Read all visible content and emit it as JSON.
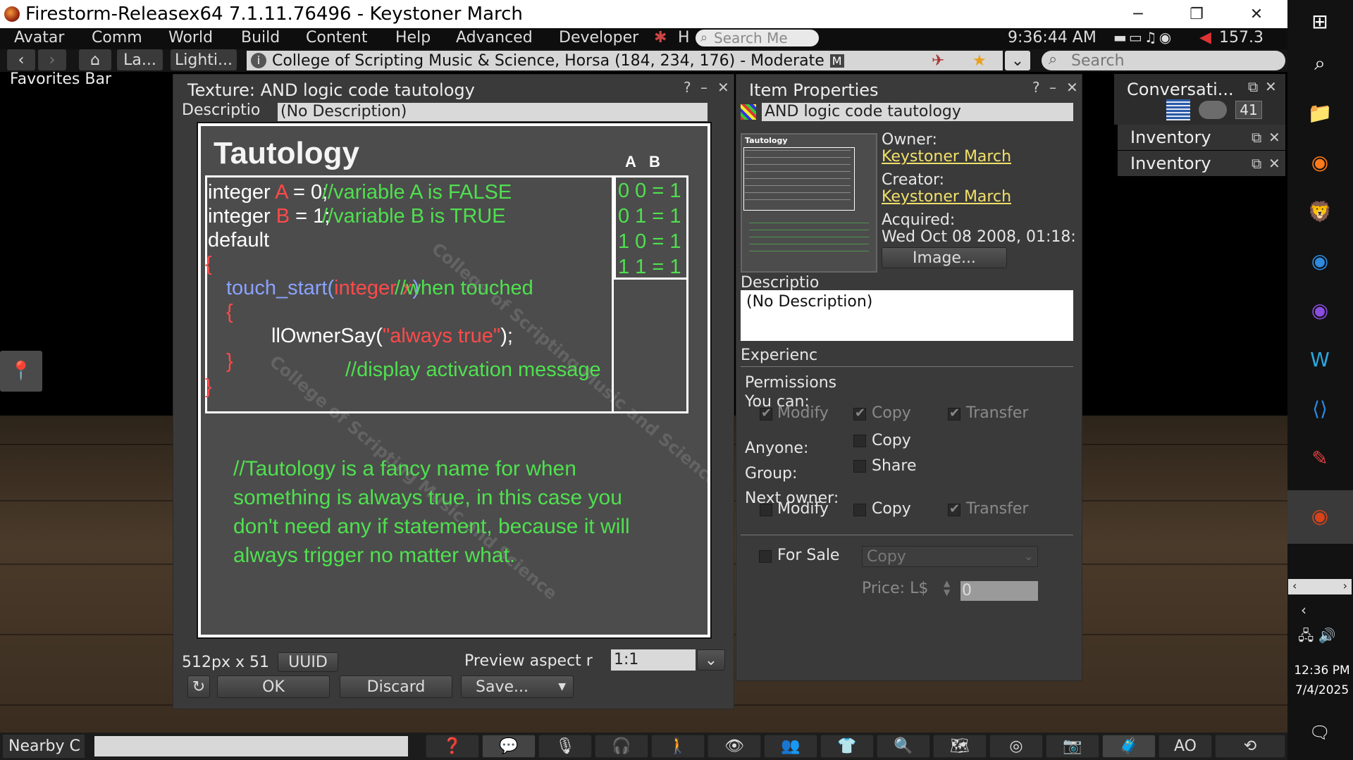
{
  "window": {
    "title": "Firestorm-Releasex64 7.1.11.76496 - Keystoner March",
    "minimize": "─",
    "restore": "❐",
    "close": "✕"
  },
  "menu": {
    "items": [
      "Avatar",
      "Comm",
      "World",
      "Build",
      "Content",
      "Help",
      "Advanced",
      "Developer"
    ],
    "search_placeholder": "Search Me",
    "h_label": "H",
    "clock": "9:36:44 AM",
    "fps": "157.3"
  },
  "nav": {
    "back": "‹",
    "forward": "›",
    "home": "⌂",
    "landmark_btn": "La...",
    "lighting_btn": "Lighti...",
    "location": "College of Scripting Music & Science, Horsa (184, 234, 176) - Moderate",
    "maturity_badge": "M",
    "search_placeholder": "Search"
  },
  "favorites_bar": "Favorites Bar",
  "texture_floater": {
    "title": "Texture: AND logic code tautology",
    "help": "?",
    "min": "–",
    "close": "✕",
    "description_label": "Descriptio",
    "description_value": "(No Description)",
    "size_label": "512px x 51",
    "uuid_button": "UUID",
    "aspect_label": "Preview aspect r",
    "aspect_value": "1:1",
    "ok": "OK",
    "discard": "Discard",
    "save": "Save...",
    "image": {
      "heading": "Tautology",
      "col_a": "A",
      "col_b": "B",
      "line1_a": "integer ",
      "line1_b": "A",
      "line1_c": " = 0;",
      "line1_comment": "//variable A is FALSE",
      "line2_a": "integer ",
      "line2_b": "B",
      "line2_c": " = 1;",
      "line2_comment": "//variable B is TRUE",
      "line3": "default",
      "brace_open": "{",
      "brace_close": "}",
      "touch_fn": "touch_start(",
      "touch_arg": "integer x",
      "touch_close": ")",
      "touch_comment": "//when touched",
      "inner_open": "{",
      "inner_close": "}",
      "say_a": "llOwnerSay(",
      "say_b": "\"always true\"",
      "say_c": ");",
      "display_comment": "//display activation message",
      "truth_rows": [
        "0  0 = 1",
        "0  1 = 1",
        "1  0 = 1",
        "1  1 = 1"
      ],
      "note_line1": "//Tautology is a fancy name for when",
      "note_line2": "something is always true, in this case you",
      "note_line3": "don't need any if statement, because it will",
      "note_line4": "always trigger no matter what.",
      "watermark": "College of Scripting Music and Science"
    }
  },
  "item_props": {
    "title": "Item Properties",
    "help": "?",
    "min": "–",
    "close": "✕",
    "name": "AND logic code tautology",
    "owner_label": "Owner:",
    "owner": "Keystoner March",
    "creator_label": "Creator:",
    "creator": "Keystoner March",
    "acquired_label": "Acquired:",
    "acquired": "Wed Oct 08 2008, 01:18:",
    "image_button": "Image...",
    "description_label": "Descriptio",
    "description_value": "(No Description)",
    "experience_label": "Experienc",
    "permissions_label": "Permissions",
    "you_can_label": "You can:",
    "modify": "Modify",
    "copy": "Copy",
    "transfer": "Transfer",
    "anyone_label": "Anyone:",
    "group_label": "Group:",
    "share": "Share",
    "next_owner_label": "Next owner:",
    "for_sale": "For Sale",
    "sale_type": "Copy",
    "price_label": "Price: L$",
    "price_value": "0"
  },
  "side": {
    "conversations": "Conversati...",
    "badge": "41",
    "inventory1": "Inventory",
    "inventory2": "Inventory",
    "restore": "⧉",
    "close": "✕"
  },
  "bottom": {
    "nearby_chat": "Nearby C",
    "ao": "AO"
  },
  "taskbar": {
    "time": "12:36 PM",
    "date": "7/4/2025"
  }
}
